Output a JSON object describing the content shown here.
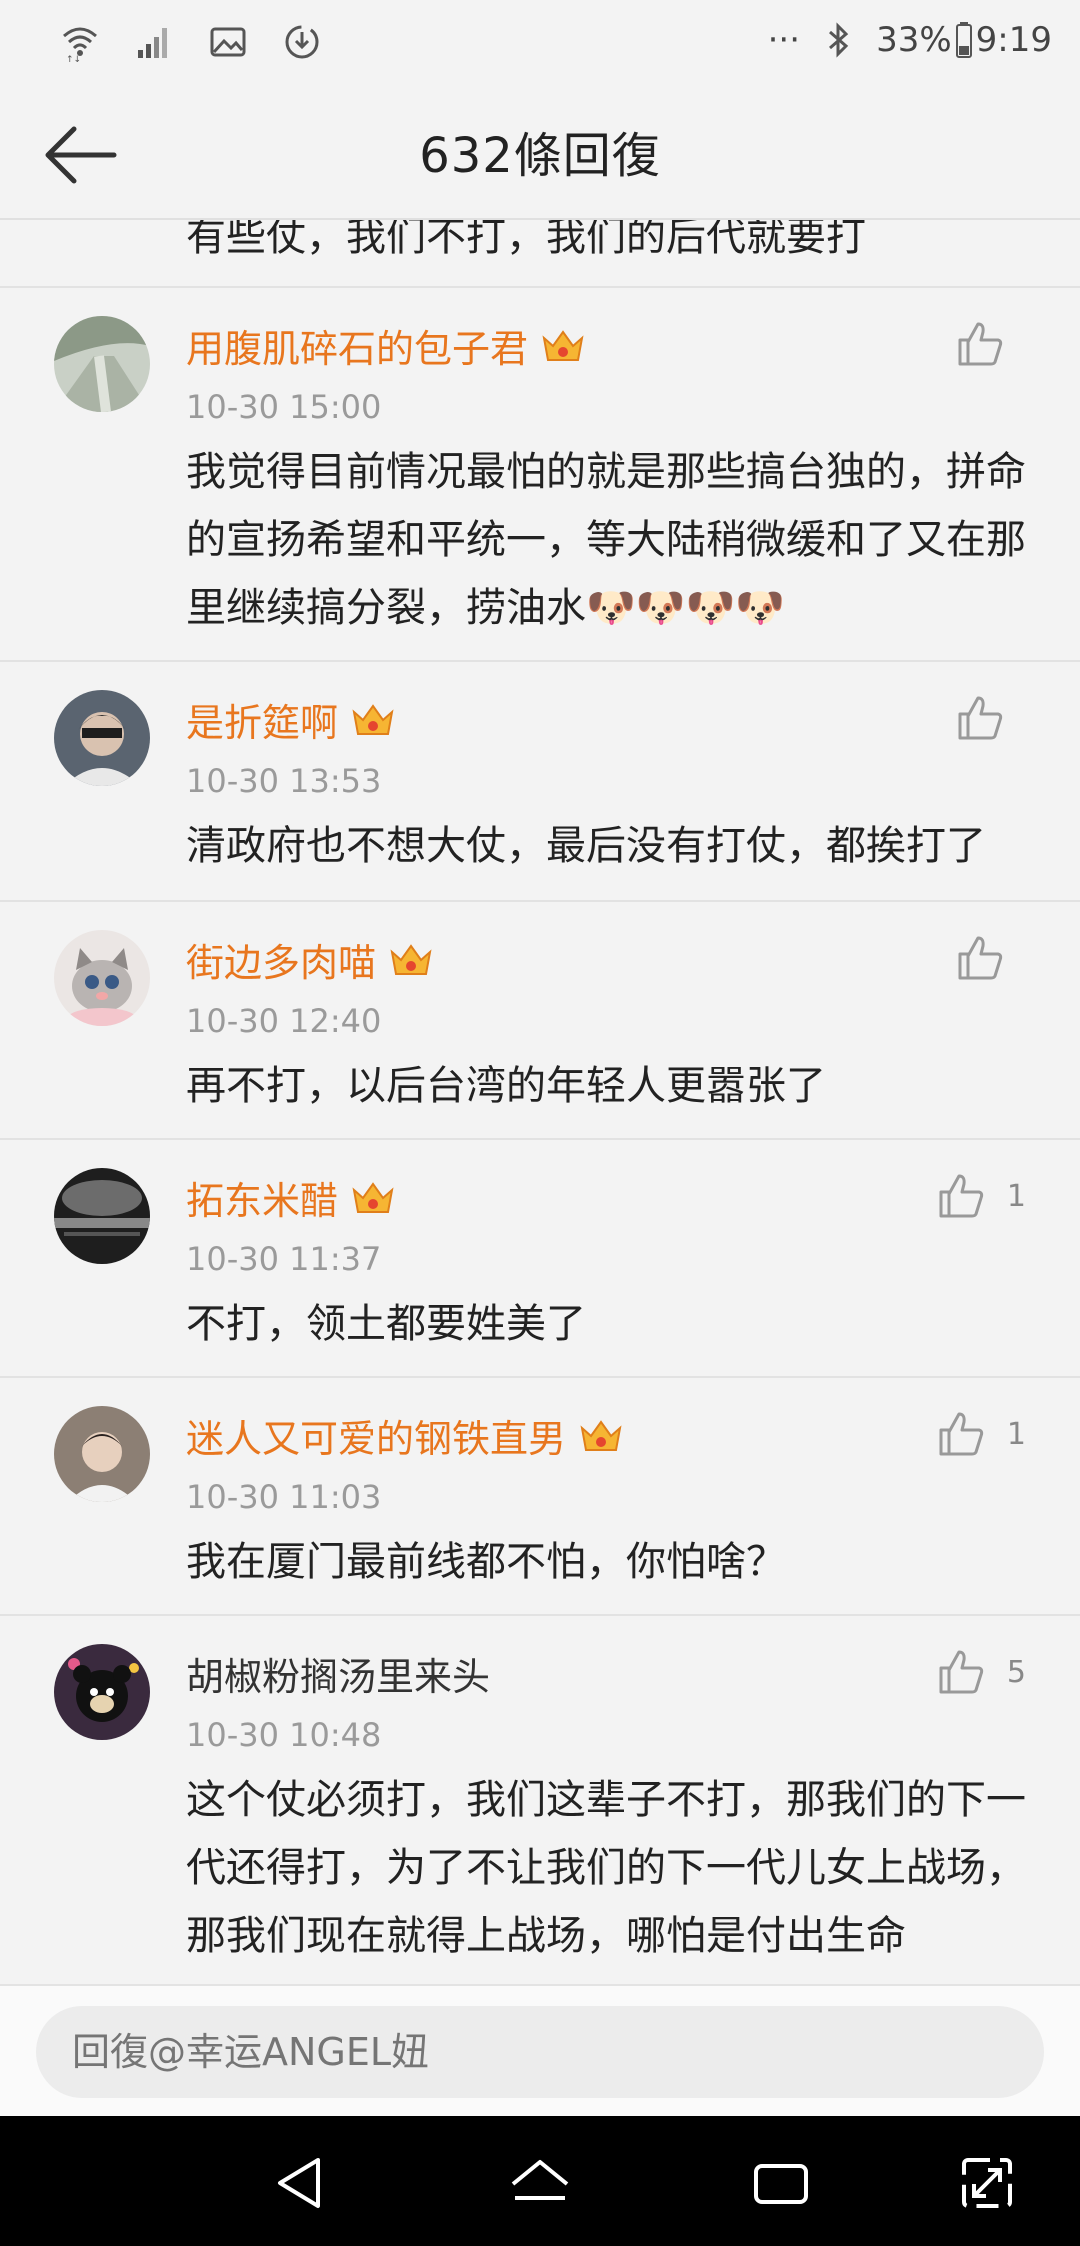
{
  "status_bar": {
    "more": "···",
    "battery": "33%",
    "time": "9:19"
  },
  "header": {
    "title": "632條回復"
  },
  "partial_comment": {
    "text": "有些仗，我们不打，我们的后代就要打"
  },
  "comments": [
    {
      "user": "用腹肌碎石的包子君",
      "time": "10-30 15:00",
      "text": "我觉得目前情况最怕的就是那些搞台独的，拼命的宣扬希望和平统一，等大陆稍微缓和了又在那里继续搞分裂，捞油水🐶🐶🐶🐶",
      "likes": ""
    },
    {
      "user": "是折筵啊",
      "time": "10-30 13:53",
      "text": "清政府也不想大仗，最后没有打仗，都挨打了",
      "likes": ""
    },
    {
      "user": "街边多肉喵",
      "time": "10-30 12:40",
      "text": "再不打，以后台湾的年轻人更嚣张了",
      "likes": ""
    },
    {
      "user": "拓东米醋",
      "time": "10-30 11:37",
      "text": "不打，领土都要姓美了",
      "likes": "1"
    },
    {
      "user": "迷人又可爱的钢铁直男",
      "time": "10-30 11:03",
      "text": "我在厦门最前线都不怕，你怕啥？",
      "likes": "1"
    },
    {
      "user": "胡椒粉搁汤里来头",
      "time": "10-30 10:48",
      "text": "这个仗必须打，我们这辈子不打，那我们的下一代还得打，为了不让我们的下一代儿女上战场，那我们现在就得上战场，哪怕是付出生命",
      "likes": "5"
    }
  ],
  "reply": {
    "placeholder": "回復@幸运ANGEL妞"
  },
  "colors": {
    "username_vip": "#e8761e",
    "time": "#9a9a9a",
    "background": "#f3f3f3"
  }
}
